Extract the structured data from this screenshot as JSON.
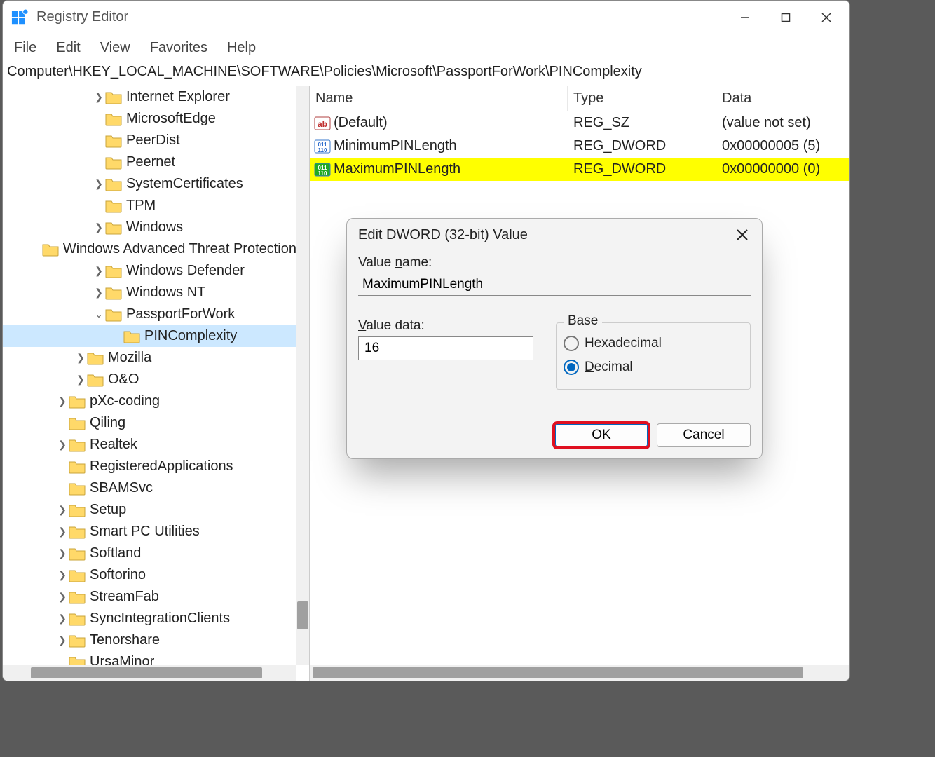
{
  "title": "Registry Editor",
  "menu": {
    "file": "File",
    "edit": "Edit",
    "view": "View",
    "favorites": "Favorites",
    "help": "Help"
  },
  "address": "Computer\\HKEY_LOCAL_MACHINE\\SOFTWARE\\Policies\\Microsoft\\PassportForWork\\PINComplexity",
  "tree": [
    {
      "indent": 5,
      "caret": ">",
      "label": "Internet Explorer"
    },
    {
      "indent": 5,
      "caret": "",
      "label": "MicrosoftEdge"
    },
    {
      "indent": 5,
      "caret": "",
      "label": "PeerDist"
    },
    {
      "indent": 5,
      "caret": "",
      "label": "Peernet"
    },
    {
      "indent": 5,
      "caret": ">",
      "label": "SystemCertificates"
    },
    {
      "indent": 5,
      "caret": "",
      "label": "TPM"
    },
    {
      "indent": 5,
      "caret": ">",
      "label": "Windows"
    },
    {
      "indent": 5,
      "caret": "",
      "label": "Windows Advanced Threat Protection"
    },
    {
      "indent": 5,
      "caret": ">",
      "label": "Windows Defender"
    },
    {
      "indent": 5,
      "caret": ">",
      "label": "Windows NT"
    },
    {
      "indent": 5,
      "caret": "v",
      "label": "PassportForWork"
    },
    {
      "indent": 6,
      "caret": "",
      "label": "PINComplexity",
      "selected": true
    },
    {
      "indent": 4,
      "caret": ">",
      "label": "Mozilla"
    },
    {
      "indent": 4,
      "caret": ">",
      "label": "O&O"
    },
    {
      "indent": 3,
      "caret": ">",
      "label": "pXc-coding"
    },
    {
      "indent": 3,
      "caret": "",
      "label": "Qiling"
    },
    {
      "indent": 3,
      "caret": ">",
      "label": "Realtek"
    },
    {
      "indent": 3,
      "caret": "",
      "label": "RegisteredApplications"
    },
    {
      "indent": 3,
      "caret": "",
      "label": "SBAMSvc"
    },
    {
      "indent": 3,
      "caret": ">",
      "label": "Setup"
    },
    {
      "indent": 3,
      "caret": ">",
      "label": "Smart PC Utilities"
    },
    {
      "indent": 3,
      "caret": ">",
      "label": "Softland"
    },
    {
      "indent": 3,
      "caret": ">",
      "label": "Softorino"
    },
    {
      "indent": 3,
      "caret": ">",
      "label": "StreamFab"
    },
    {
      "indent": 3,
      "caret": ">",
      "label": "SyncIntegrationClients"
    },
    {
      "indent": 3,
      "caret": ">",
      "label": "Tenorshare"
    },
    {
      "indent": 3,
      "caret": "",
      "label": "UrsaMinor"
    }
  ],
  "columns": {
    "name": "Name",
    "type": "Type",
    "data": "Data"
  },
  "values": [
    {
      "icon": "sz",
      "name": "(Default)",
      "type": "REG_SZ",
      "data": "(value not set)",
      "selected": false
    },
    {
      "icon": "dw",
      "name": "MinimumPINLength",
      "type": "REG_DWORD",
      "data": "0x00000005 (5)",
      "selected": false
    },
    {
      "icon": "dw",
      "name": "MaximumPINLength",
      "type": "REG_DWORD",
      "data": "0x00000000 (0)",
      "selected": true
    }
  ],
  "dialog": {
    "title": "Edit DWORD (32-bit) Value",
    "value_name_label": "Value name:",
    "value_name": "MaximumPINLength",
    "value_data_label": "Value data:",
    "value_data": "16",
    "base_label": "Base",
    "hex_label": "Hexadecimal",
    "dec_label": "Decimal",
    "base": "decimal",
    "ok": "OK",
    "cancel": "Cancel"
  }
}
